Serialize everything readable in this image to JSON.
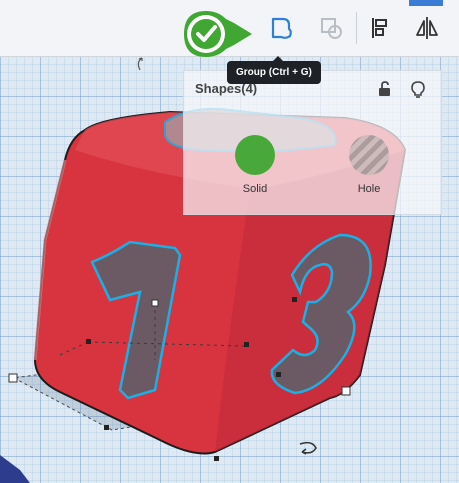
{
  "toolbar": {
    "group_icon": "group-shapes-icon",
    "ungroup_icon": "ungroup-shapes-icon",
    "align_icon": "align-icon",
    "mirror_icon": "mirror-icon",
    "check_icon": "check-icon"
  },
  "tooltip": {
    "text": "Group (Ctrl + G)"
  },
  "shapes_panel": {
    "title": "Shapes(4)",
    "lock_icon": "lock-icon",
    "light_icon": "lightbulb-icon",
    "options": [
      {
        "label": "Solid",
        "color": "#48a83a"
      },
      {
        "label": "Hole"
      }
    ]
  },
  "scene": {
    "cube_color": "#d8343f",
    "outline_color": "#1ab0e6",
    "visible_numbers": [
      "1",
      "3"
    ]
  }
}
